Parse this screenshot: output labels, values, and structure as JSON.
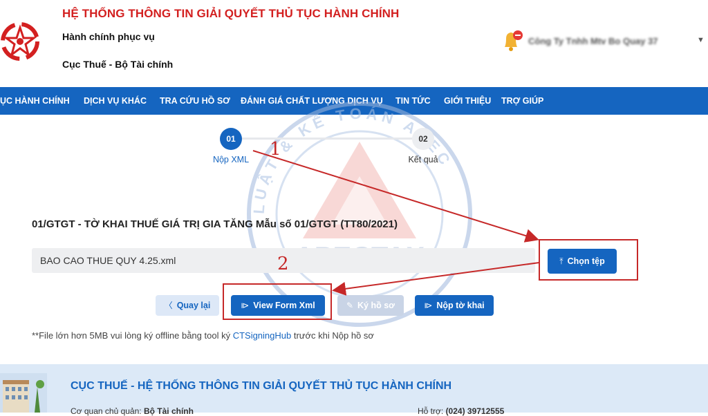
{
  "header": {
    "system_title": "HỆ THỐNG THÔNG TIN GIẢI QUYẾT THỦ TỤC HÀNH CHÍNH",
    "subtitle_1": "Hành chính phục vụ",
    "subtitle_2": "Cục Thuế - Bộ Tài chính",
    "company_name": "Công Ty Tnhh Mtv Bo Quay 37"
  },
  "nav": {
    "items": [
      {
        "label": "ỤC HÀNH CHÍNH"
      },
      {
        "label": "DỊCH VỤ KHÁC"
      },
      {
        "label": "TRA CỨU HỒ SƠ"
      },
      {
        "label": "ĐÁNH GIÁ CHẤT LƯỢNG DỊCH VỤ"
      },
      {
        "label": "TIN TỨC"
      },
      {
        "label": "GIỚI THIỆU"
      },
      {
        "label": "TRỢ GIÚP"
      }
    ]
  },
  "stepper": {
    "steps": [
      {
        "number": "01",
        "label": "Nộp XML",
        "active": true
      },
      {
        "number": "02",
        "label": "Kết quả",
        "active": false
      }
    ]
  },
  "form": {
    "title": "01/GTGT - TỜ KHAI THUẾ GIÁ TRỊ GIA TĂNG Mẫu số 01/GTGT (TT80/2021)",
    "file_name": "BAO CAO THUE QUY 4.25.xml",
    "choose_file_label": "Chọn tệp"
  },
  "actions": {
    "back_label": "Quay lại",
    "view_form_label": "View Form Xml",
    "sign_label": "Ký hồ sơ",
    "submit_label": "Nộp tờ khai"
  },
  "note": {
    "prefix": "**File lớn hơn 5MB vui lòng ký offline bằng tool ký ",
    "link_text": "CTSigningHub",
    "suffix": " trước khi Nộp hồ sơ"
  },
  "annotations": {
    "marker_1": "1",
    "marker_2": "2",
    "color": "#c62828"
  },
  "watermark": {
    "brand": "APECTAX",
    "ring_text": "LUẬT & KẾ TOÁN APEC"
  },
  "footer": {
    "title": "CỤC THUẾ - HỆ THỐNG THÔNG TIN GIẢI QUYẾT THỦ TỤC HÀNH CHÍNH",
    "agency_label": "Cơ quan chủ quản:",
    "agency_value": "Bộ Tài chính",
    "support_label": "Hỗ trợ:",
    "support_value": "(024) 39712555"
  },
  "colors": {
    "primary": "#1565c0",
    "title_red": "#d32020",
    "footer_bg": "#dce9f7"
  }
}
